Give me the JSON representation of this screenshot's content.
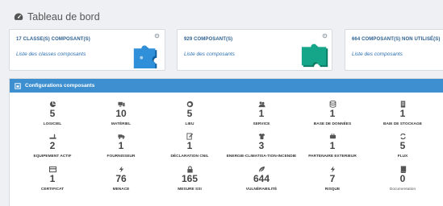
{
  "page": {
    "title": "Tableau de bord"
  },
  "cards": [
    {
      "title": "17 CLASSE(S) COMPOSANT(S)",
      "link": "Liste des classes composants",
      "puzzle_color": "#2f8fd8",
      "puzzle_dark": "#0f5e9e"
    },
    {
      "title": "929 COMPOSANT(S)",
      "link": "Liste des composants",
      "puzzle_color": "#15a589",
      "puzzle_dark": "#0d7a64"
    },
    {
      "title": "664 COMPOSANT(S) NON UTILISÉ(S)",
      "link": "Liste des composants",
      "puzzle_color": "#2f8fd8",
      "puzzle_dark": "#0f5e9e"
    }
  ],
  "panel": {
    "title": "Configurations composants",
    "header_color": "#3d8fd0",
    "items": [
      {
        "icon": "software-icon",
        "value": "5",
        "label": "LOGICIEL"
      },
      {
        "icon": "hardware-icon",
        "value": "10",
        "label": "MATÉRIEL"
      },
      {
        "icon": "globe-icon",
        "value": "5",
        "label": "LIEU"
      },
      {
        "icon": "users-icon",
        "value": "1",
        "label": "SERVICE"
      },
      {
        "icon": "database-icon",
        "value": "1",
        "label": "BASE DE DONNÉES"
      },
      {
        "icon": "storage-icon",
        "value": "1",
        "label": "BAIE DE STOCKAGE"
      },
      {
        "icon": "equipment-icon",
        "value": "2",
        "label": "EQUIPEMENT ACTIF"
      },
      {
        "icon": "truck-icon",
        "value": "1",
        "label": "FOURNISSEUR"
      },
      {
        "icon": "edit-icon",
        "value": "1",
        "label": "DÉCLARATION CNIL"
      },
      {
        "icon": "shirt-icon",
        "value": "3",
        "label": "ENERGIE-CLIMATISA-TION-INCENDIE"
      },
      {
        "icon": "partner-icon",
        "value": "1",
        "label": "PARTENAIRE EXTERIEUR"
      },
      {
        "icon": "exchange-icon",
        "value": "5",
        "label": "FLUX"
      },
      {
        "icon": "certificate-icon",
        "value": "1",
        "label": "CERTIFICAT"
      },
      {
        "icon": "bolt-icon",
        "value": "76",
        "label": "MENACE"
      },
      {
        "icon": "lock-icon",
        "value": "165",
        "label": "MESURE SSI"
      },
      {
        "icon": "leaf-icon",
        "value": "644",
        "label": "VULNÉRABILITÉ"
      },
      {
        "icon": "bolt-icon",
        "value": "7",
        "label": "RISQUE"
      },
      {
        "icon": "book-icon",
        "value": "0",
        "label": "Documentation"
      }
    ]
  }
}
